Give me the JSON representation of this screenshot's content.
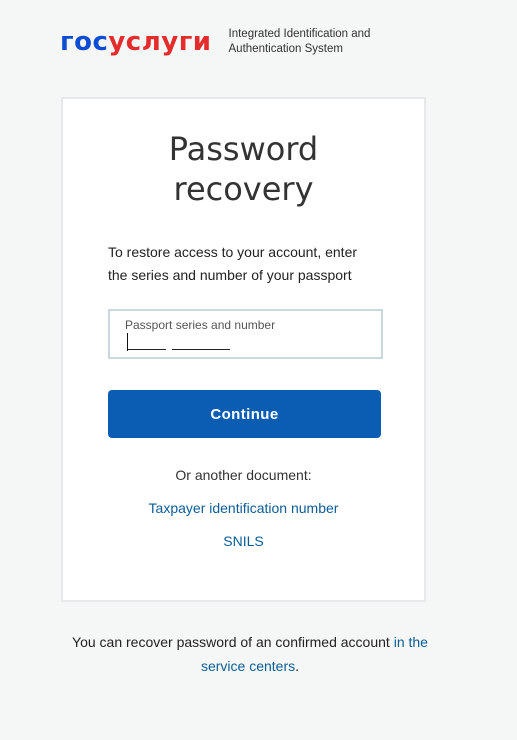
{
  "header": {
    "logo": {
      "part_blue": "гос",
      "part_red": "услуги"
    },
    "tagline": "Integrated Identification and Authentication System"
  },
  "card": {
    "title": "Password recovery",
    "description": "To restore access to your account, enter the series and number of your passport",
    "passport_field": {
      "label": "Passport series and number",
      "value": ""
    },
    "continue_label": "Continue",
    "alternative_label": "Or another document:",
    "alternative_links": {
      "inn": "Taxpayer identification number",
      "snils": "SNILS"
    }
  },
  "footer": {
    "text": "You can recover password of an confirmed account",
    "link": "in the service centers",
    "suffix": "."
  },
  "colors": {
    "brand_blue": "#0d4cd3",
    "brand_red": "#e52c2c",
    "button": "#0b5db3",
    "link": "#0b5d96"
  }
}
